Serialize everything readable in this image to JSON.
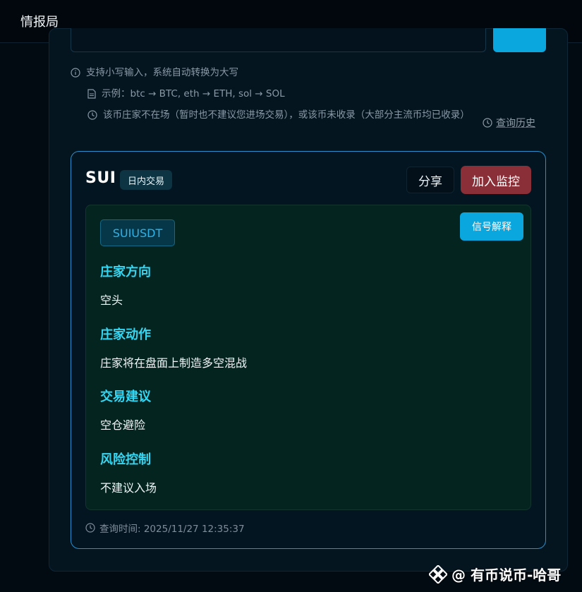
{
  "app": {
    "title": "情报局"
  },
  "hints": {
    "lowercase": "支持小写输入，系统自动转换为大写",
    "example": "示例：btc → BTC, eth → ETH, sol → SOL",
    "notice": "该币庄家不在场（暂时也不建议您进场交易），或该币未收录（大部分主流币均已收录）",
    "history_link": "查询历史"
  },
  "result": {
    "symbol": "SUI",
    "mode": "日内交易",
    "share_label": "分享",
    "monitor_label": "加入监控",
    "pair": "SUIUSDT",
    "explain_label": "信号解释",
    "sections": [
      {
        "title": "庄家方向",
        "value": "空头"
      },
      {
        "title": "庄家动作",
        "value": "庄家将在盘面上制造多空混战"
      },
      {
        "title": "交易建议",
        "value": "空仓避险"
      },
      {
        "title": "风险控制",
        "value": "不建议入场"
      }
    ],
    "query_time": "查询时间: 2025/11/27 12:35:37"
  },
  "watermark": {
    "text": "@ 有币说币-哈哥"
  },
  "colors": {
    "accent": "#0aa6de",
    "danger": "#8a2f37",
    "section_title": "#35d6f2",
    "card_border": "#2a8fca"
  }
}
